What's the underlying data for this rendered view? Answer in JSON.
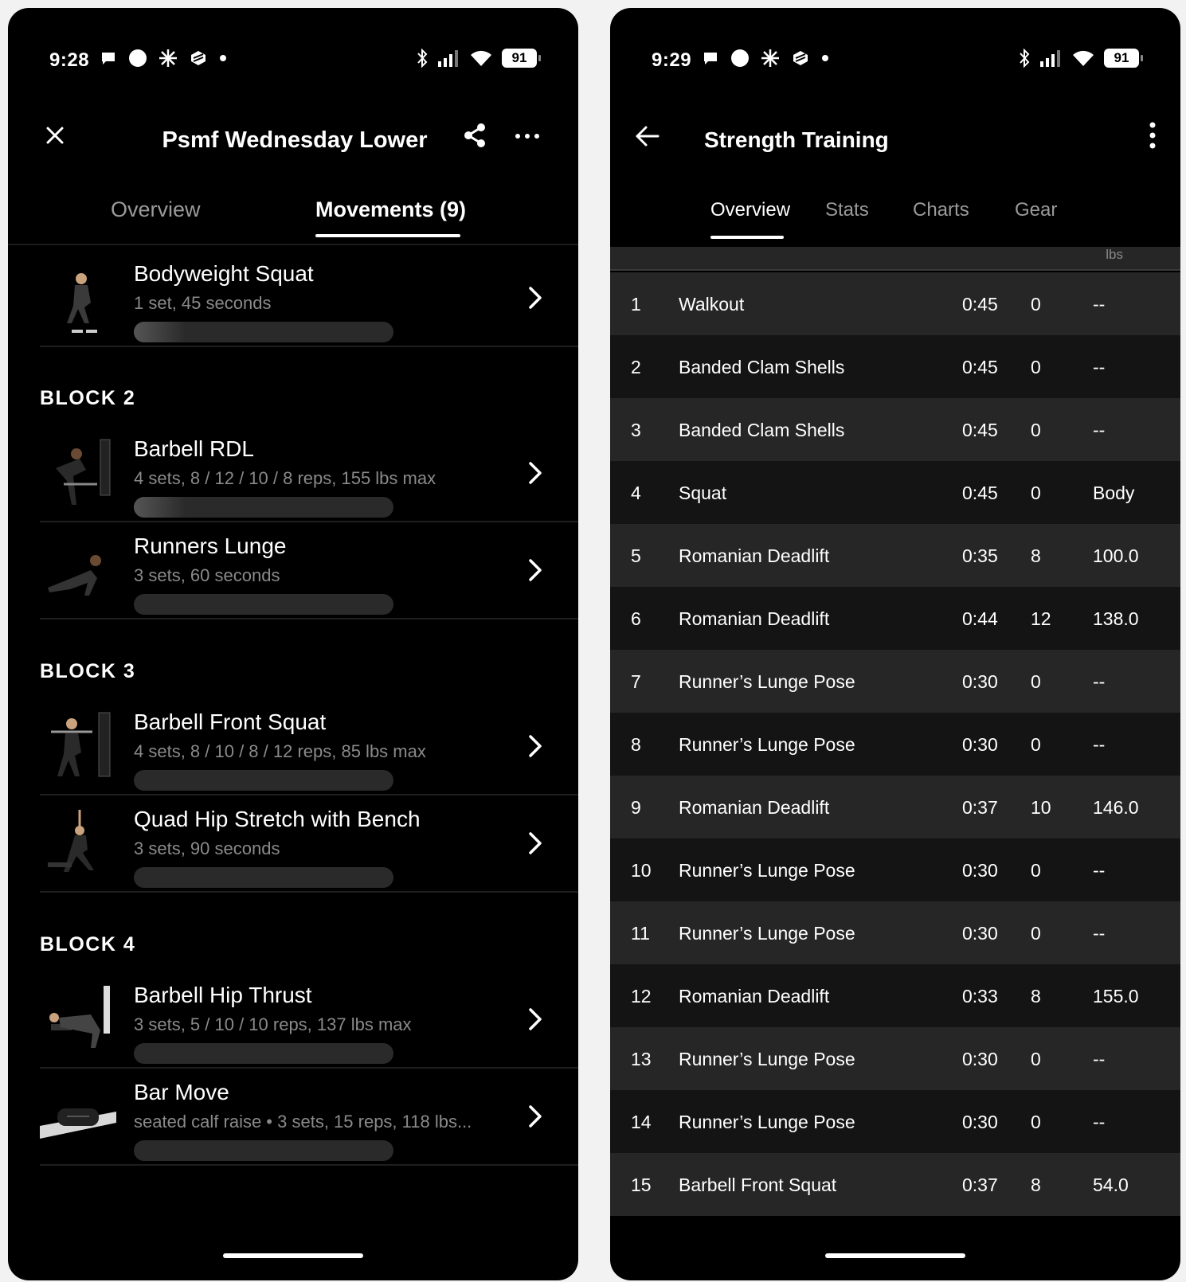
{
  "left": {
    "status": {
      "time": "9:28",
      "battery": "91"
    },
    "header": {
      "title": "Psmf Wednesday Lower"
    },
    "tabs": [
      {
        "label": "Overview"
      },
      {
        "label": "Movements (9)"
      }
    ],
    "items": [
      {
        "name": "Bodyweight Squat",
        "detail": "1 set, 45 seconds"
      },
      {
        "name": "Barbell RDL",
        "detail": "4 sets, 8 / 12 / 10 / 8 reps, 155 lbs max"
      },
      {
        "name": "Runners Lunge",
        "detail": "3 sets, 60 seconds"
      },
      {
        "name": "Barbell Front Squat",
        "detail": "4 sets, 8 / 10 / 8 / 12 reps, 85 lbs max"
      },
      {
        "name": "Quad Hip Stretch with Bench",
        "detail": "3 sets, 90 seconds"
      },
      {
        "name": "Barbell Hip Thrust",
        "detail": "3 sets, 5 / 10 / 10 reps, 137 lbs max"
      },
      {
        "name": "Bar Move",
        "detail": "seated calf raise • 3 sets, 15 reps, 118 lbs..."
      }
    ],
    "blocks": [
      "BLOCK 2",
      "BLOCK 3",
      "BLOCK 4"
    ]
  },
  "right": {
    "status": {
      "time": "9:29",
      "battery": "91"
    },
    "header": {
      "title": "Strength Training"
    },
    "tabs": [
      {
        "label": "Overview"
      },
      {
        "label": "Stats"
      },
      {
        "label": "Charts"
      },
      {
        "label": "Gear"
      }
    ],
    "table": {
      "unit_header": "lbs",
      "rows": [
        {
          "num": "1",
          "name": "Walkout",
          "time": "0:45",
          "reps": "0",
          "weight": "--"
        },
        {
          "num": "2",
          "name": "Banded Clam Shells",
          "time": "0:45",
          "reps": "0",
          "weight": "--"
        },
        {
          "num": "3",
          "name": "Banded Clam Shells",
          "time": "0:45",
          "reps": "0",
          "weight": "--"
        },
        {
          "num": "4",
          "name": "Squat",
          "time": "0:45",
          "reps": "0",
          "weight": "Body"
        },
        {
          "num": "5",
          "name": "Romanian Deadlift",
          "time": "0:35",
          "reps": "8",
          "weight": "100.0"
        },
        {
          "num": "6",
          "name": "Romanian Deadlift",
          "time": "0:44",
          "reps": "12",
          "weight": "138.0"
        },
        {
          "num": "7",
          "name": "Runner’s Lunge Pose",
          "time": "0:30",
          "reps": "0",
          "weight": "--"
        },
        {
          "num": "8",
          "name": "Runner’s Lunge Pose",
          "time": "0:30",
          "reps": "0",
          "weight": "--"
        },
        {
          "num": "9",
          "name": "Romanian Deadlift",
          "time": "0:37",
          "reps": "10",
          "weight": "146.0"
        },
        {
          "num": "10",
          "name": "Runner’s Lunge Pose",
          "time": "0:30",
          "reps": "0",
          "weight": "--"
        },
        {
          "num": "11",
          "name": "Runner’s Lunge Pose",
          "time": "0:30",
          "reps": "0",
          "weight": "--"
        },
        {
          "num": "12",
          "name": "Romanian Deadlift",
          "time": "0:33",
          "reps": "8",
          "weight": "155.0"
        },
        {
          "num": "13",
          "name": "Runner’s Lunge Pose",
          "time": "0:30",
          "reps": "0",
          "weight": "--"
        },
        {
          "num": "14",
          "name": "Runner’s Lunge Pose",
          "time": "0:30",
          "reps": "0",
          "weight": "--"
        },
        {
          "num": "15",
          "name": "Barbell Front Squat",
          "time": "0:37",
          "reps": "8",
          "weight": "54.0"
        }
      ]
    }
  }
}
